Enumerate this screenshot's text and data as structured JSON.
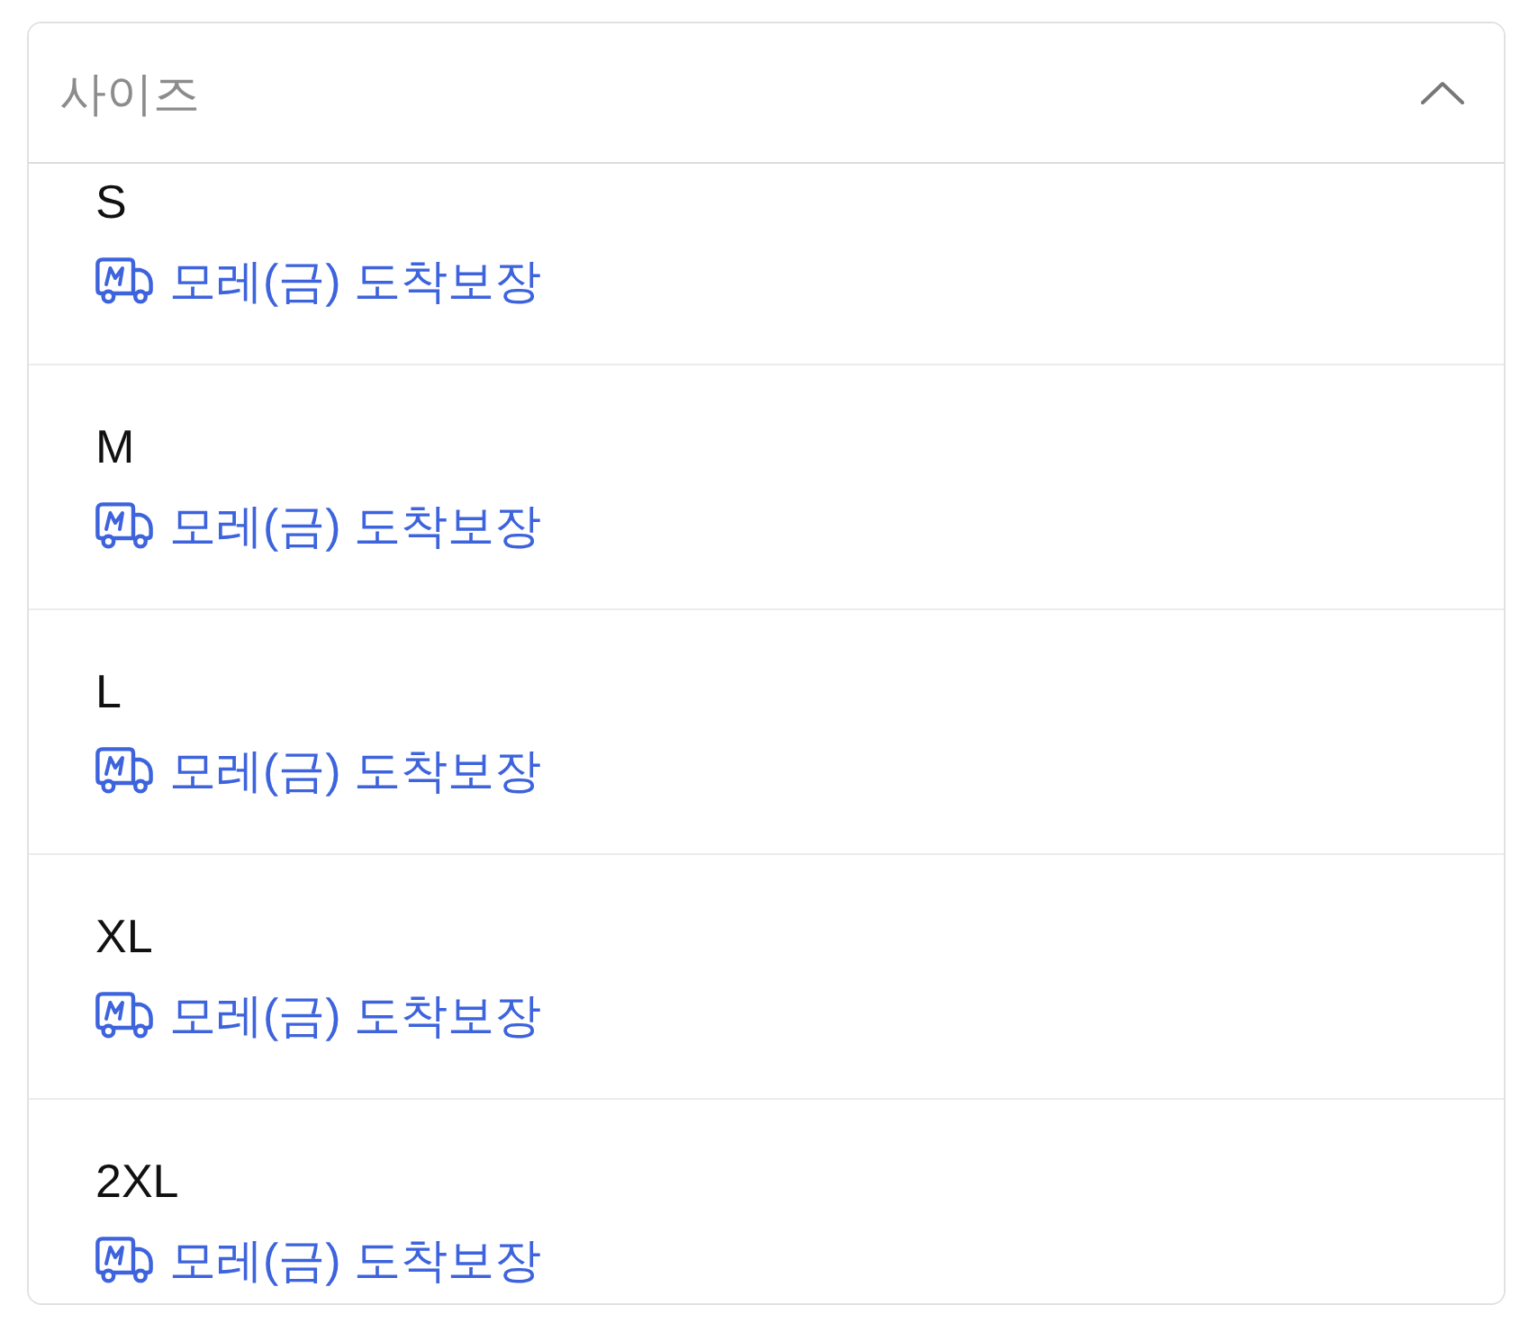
{
  "dropdown": {
    "placeholder": "사이즈",
    "expanded": true
  },
  "options": [
    {
      "label": "S",
      "delivery": "모레(금) 도착보장"
    },
    {
      "label": "M",
      "delivery": "모레(금) 도착보장"
    },
    {
      "label": "L",
      "delivery": "모레(금) 도착보장"
    },
    {
      "label": "XL",
      "delivery": "모레(금) 도착보장"
    },
    {
      "label": "2XL",
      "delivery": "모레(금) 도착보장"
    }
  ]
}
